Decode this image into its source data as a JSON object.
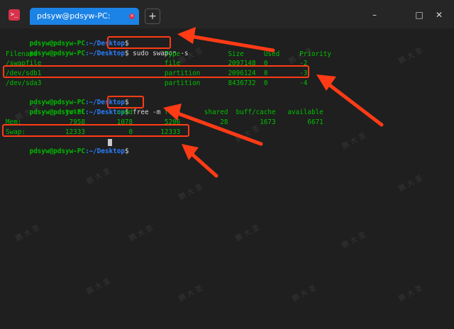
{
  "window": {
    "tab_title": "pdsyw@pdsyw-PC: ~/Desktop",
    "tab_close_glyph": "×",
    "add_tab_glyph": "+",
    "minimize_glyph": "–",
    "maximize_glyph": "□",
    "close_glyph": "✕"
  },
  "terminal": {
    "prompt_user": "pdsyw@pdsyw-PC",
    "prompt_path": ":~/Desktop",
    "prompt_symbol": "$",
    "cmd1": " sudo swapon -s",
    "cmd2": " free -m",
    "swap_header": "Filename                                Type            Size     Used     Priority",
    "swap_rows": [
      "/swapfile                               file            2097148  0        -2",
      "/dev/sdb1                               partition       2096124  0        -3",
      "/dev/sda3                               partition       8436732  0        -4"
    ],
    "free_header": "               total        used        free      shared  buff/cache   available",
    "free_mem": "Mem:            7958        1078        5206          28        1673        6671",
    "free_swap": "Swap:          12333           0       12333"
  },
  "accent_colors": {
    "tab": "#1c83e6",
    "annotation": "#ff3b16",
    "prompt_user": "#00b900",
    "prompt_path": "#2b7fff",
    "output": "#00c000"
  },
  "watermark_glyphs": [
    "鹏",
    "大",
    "圣"
  ]
}
